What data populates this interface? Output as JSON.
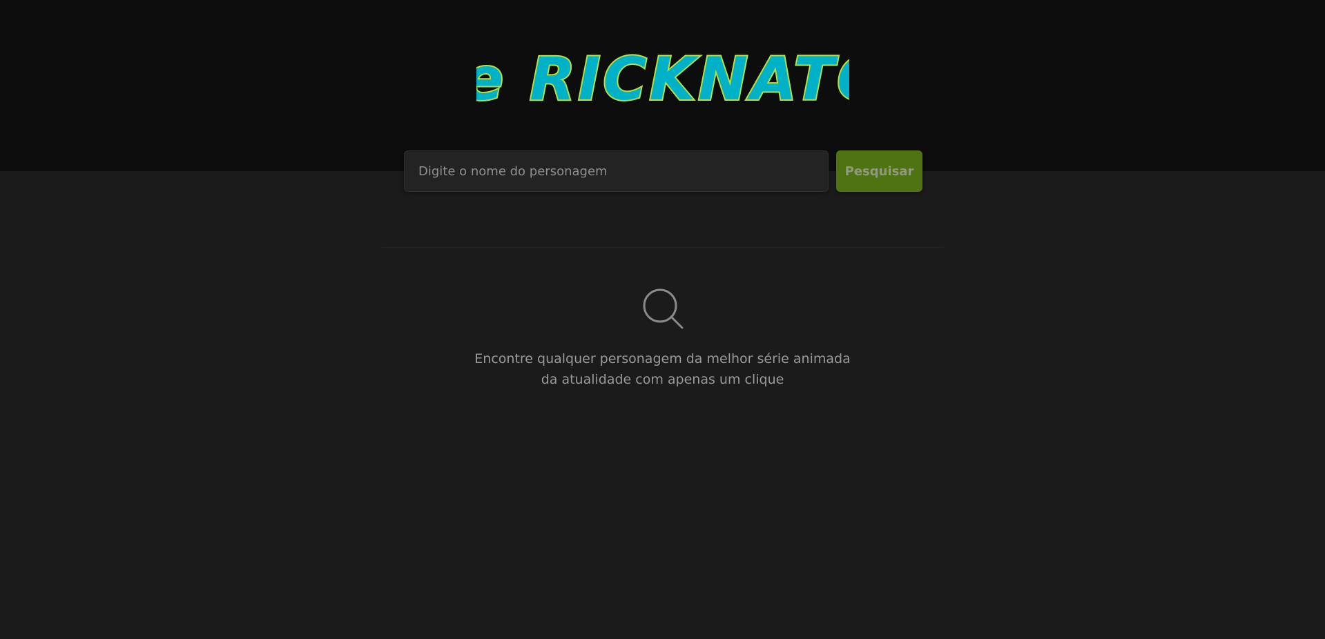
{
  "header": {
    "logo_text": "the RICKNATOR",
    "logo_colors": {
      "fill": "#00b1c8",
      "outline": "#b8e03a"
    }
  },
  "search": {
    "placeholder": "Digite o nome do personagem",
    "value": "",
    "button_label": "Pesquisar"
  },
  "empty_state": {
    "icon": "search-icon",
    "message": "Encontre qualquer personagem da melhor série animada da atualidade com apenas um clique"
  },
  "colors": {
    "header_bg": "#0d0d0d",
    "page_bg": "#1b1b1b",
    "accent": "#4e7310"
  }
}
